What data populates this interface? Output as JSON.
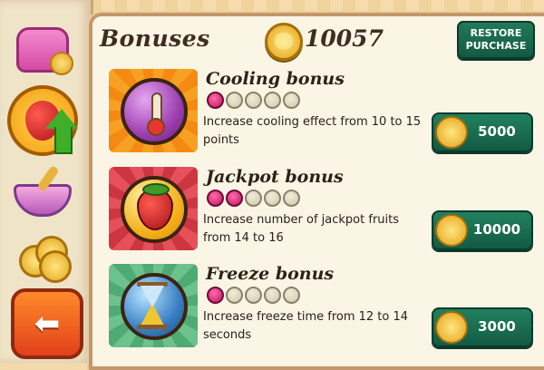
{
  "header": {
    "title": "Bonuses",
    "coins": "10057",
    "restore_label": "RESTORE PURCHASE"
  },
  "sidebar": {
    "items": [
      {
        "icon": "jelly-trophy-icon"
      },
      {
        "icon": "strawberry-upgrade-icon",
        "active": true
      },
      {
        "icon": "bowl-spoon-icon"
      },
      {
        "icon": "coins-icon"
      },
      {
        "icon": "back-arrow-icon"
      }
    ]
  },
  "bonuses": [
    {
      "name": "Cooling bonus",
      "level": 1,
      "max_level": 5,
      "description": "Increase cooling effect from 10 to 15 points",
      "price": "5000",
      "icon": "thermometer-icon",
      "tile_color": "#f7a124"
    },
    {
      "name": "Jackpot bonus",
      "level": 2,
      "max_level": 5,
      "description": "Increase number of jackpot fruits from 14 to 16",
      "price": "10000",
      "icon": "strawberry-icon",
      "tile_color": "#e6505a"
    },
    {
      "name": "Freeze bonus",
      "level": 1,
      "max_level": 5,
      "description": "Increase freeze time from 12 to 14 seconds",
      "price": "3000",
      "icon": "hourglass-icon",
      "tile_color": "#6dc18d"
    }
  ],
  "colors": {
    "button_green": "#135a43",
    "level_filled": "#c21565",
    "coin_gold": "#f4b21c"
  }
}
